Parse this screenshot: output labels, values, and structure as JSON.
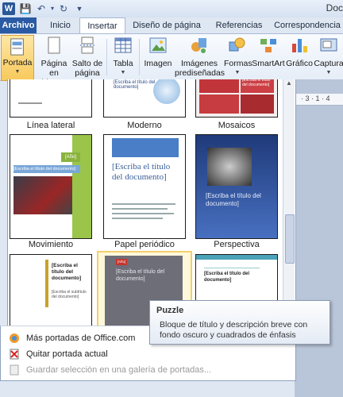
{
  "titlebar": {
    "doc_title": "Doc"
  },
  "tabs": {
    "file": "Archivo",
    "home": "Inicio",
    "insert": "Insertar",
    "page_layout": "Diseño de página",
    "references": "Referencias",
    "mailings": "Correspondencia"
  },
  "ribbon": {
    "cover_page": "Portada",
    "blank_page_1": "Página",
    "blank_page_2": "en blanco",
    "page_break_1": "Salto de",
    "page_break_2": "página",
    "table": "Tabla",
    "picture": "Imagen",
    "clipart_1": "Imágenes",
    "clipart_2": "prediseñadas",
    "shapes": "Formas",
    "smartart": "SmartArt",
    "chart": "Gráfico",
    "screenshot": "Captura"
  },
  "gallery": {
    "row1": [
      "Línea lateral",
      "Moderno",
      "Mosaicos"
    ],
    "row2": [
      "Movimiento",
      "Papel periódico",
      "Perspectiva"
    ],
    "thumb_texts": {
      "year": "[Año]",
      "title_small": "[Escriba el título del documento]",
      "title_big": "[Escriba el título del documento]",
      "title_persp": "[Escriba el título del documento]",
      "title_moderno": "[Escriba el título del documento]",
      "title_mosaicos": "[Escriba el título del documento]",
      "r3a": "[Escriba el título del documento]",
      "r3a_sub": "[Escriba el subtítulo del documento]",
      "r3b": "[Escriba el título del documento]",
      "r3b_tag": "[Año]",
      "r3c": "[Escriba el título del documento]"
    }
  },
  "ruler": {
    "marks": "· 3 · 1 · 4"
  },
  "tooltip": {
    "title": "Puzzle",
    "body": "Bloque de título y descripción breve con fondo oscuro y cuadrados de énfasis"
  },
  "menu": {
    "more": "Más portadas de Office.com",
    "remove": "Quitar portada actual",
    "save": "Guardar selección en una galería de portadas..."
  }
}
